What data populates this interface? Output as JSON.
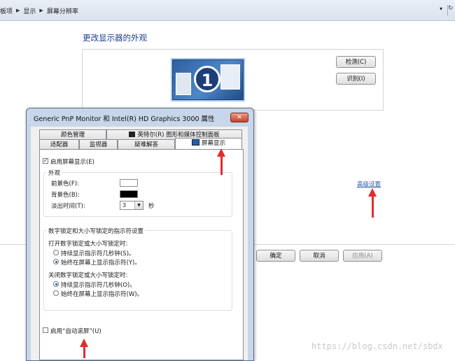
{
  "address_bar": {
    "crumbs": [
      "板项",
      "显示",
      "屏幕分辨率"
    ],
    "dropdown_glyph": "▾",
    "refresh_glyph": "↻"
  },
  "panel": {
    "title": "更改显示器的外观",
    "monitor_number": "1",
    "detect_button": "检测(C)",
    "identify_button": "识别(I)",
    "advanced_link": "高级设置",
    "ok_button": "确定",
    "cancel_button": "取消",
    "apply_button": "应用(A)"
  },
  "dialog": {
    "title": "Generic PnP Monitor 和 Intel(R) HD Graphics 3000 属性",
    "close_glyph": "✕",
    "tabs_row1": [
      "颜色管理",
      "英特尔(R) 图形和媒体控制面板"
    ],
    "tabs_row2": [
      "适配器",
      "监视器",
      "疑难解答",
      "屏幕显示"
    ],
    "enable_osd": "启用屏幕显示(E)",
    "appearance": {
      "group_label": "外观",
      "foreground_label": "前景色(F):",
      "background_label": "背景色(B):",
      "fade_label": "淡出时间(T):",
      "fade_value": "3",
      "fade_unit": "秒",
      "foreground_color": "#ffffff",
      "background_color": "#000000"
    },
    "lock_indicator": {
      "group_label": "数字锁定和大小写锁定的指示符设置",
      "on_label": "打开数字锁定或大小写锁定时:",
      "on_opt1": "持续显示指示符几秒钟(S)。",
      "on_opt2": "始终在屏幕上显示指示符(Y)。",
      "off_label": "关闭数字锁定或大小写锁定时:",
      "off_opt1": "持续显示指示符几秒钟(O)。",
      "off_opt2": "始终在屏幕上显示指示符(W)。"
    },
    "auto_scroll": "启用“自动滚屏”(U)"
  },
  "watermark": "https://blog.csdn.net/sbdx",
  "colors": {
    "arrow": "#e52a2a",
    "link": "#2a5db0",
    "title": "#1e3d8f"
  }
}
